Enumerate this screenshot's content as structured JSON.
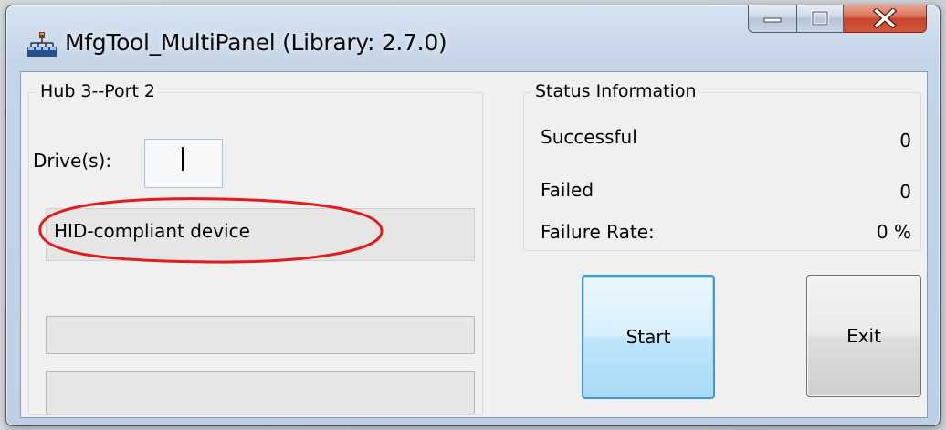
{
  "window": {
    "title": "MfgTool_MultiPanel (Library: 2.7.0)",
    "icon": "network-hub-icon",
    "buttons": [
      "minimize",
      "maximize",
      "close"
    ]
  },
  "port_panel": {
    "title": "Hub 3--Port 2",
    "drive_label": "Drive(s):",
    "drive_value": "",
    "device_text": "HID-compliant device",
    "annotation_color": "#e21b1b"
  },
  "status_panel": {
    "title": "Status Information",
    "rows": [
      {
        "label": "Successful",
        "value": "0"
      },
      {
        "label": "Failed",
        "value": "0"
      },
      {
        "label": "Failure Rate:",
        "value": "0 %"
      }
    ]
  },
  "actions": {
    "start_label": "Start",
    "exit_label": "Exit"
  },
  "colors": {
    "start_border": "#3c9bd6",
    "close_button": "#c7442a"
  }
}
